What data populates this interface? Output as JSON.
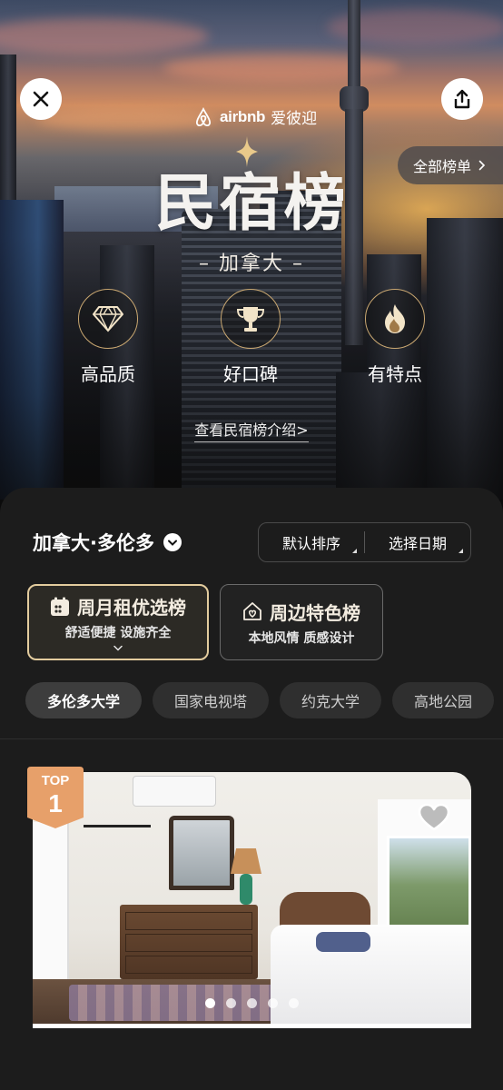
{
  "header": {
    "brand_en": "airbnb",
    "brand_cn": "爱彼迎",
    "all_lists": "全部榜单",
    "title": "民宿榜",
    "country": "– 加拿大 –",
    "intro_link": "查看民宿榜介绍>"
  },
  "features": [
    {
      "label": "高品质",
      "icon": "diamond-icon"
    },
    {
      "label": "好口碑",
      "icon": "trophy-icon"
    },
    {
      "label": "有特点",
      "icon": "flame-icon"
    }
  ],
  "filters": {
    "location": "加拿大·多伦多",
    "sort": "默认排序",
    "date": "选择日期"
  },
  "categories": [
    {
      "title": "周月租优选榜",
      "subtitle": "舒适便捷 设施齐全",
      "icon": "calendar-icon",
      "selected": true
    },
    {
      "title": "周边特色榜",
      "subtitle": "本地风情 质感设计",
      "icon": "house-heart-icon",
      "selected": false
    }
  ],
  "chips": [
    "多伦多大学",
    "国家电视塔",
    "约克大学",
    "高地公园"
  ],
  "active_chip": "多伦多大学",
  "listing": {
    "badge_top": "TOP",
    "badge_rank": "1",
    "photo_count": 5,
    "active_photo": 1
  },
  "colors": {
    "gold": "#c9a771",
    "panel_bg": "#1c1c1c",
    "badge": "#e7a06a"
  }
}
